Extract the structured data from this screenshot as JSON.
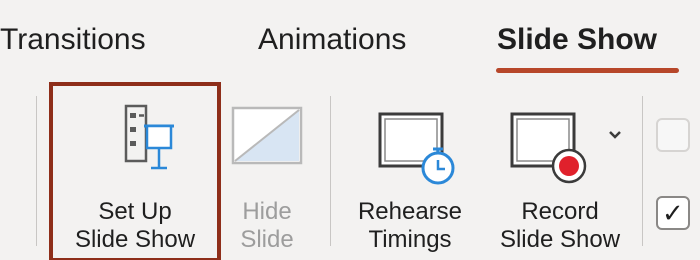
{
  "tabs": [
    {
      "label": "Transitions",
      "active": false
    },
    {
      "label": "Animations",
      "active": false
    },
    {
      "label": "Slide Show",
      "active": true
    }
  ],
  "accent_color": "#b7472a",
  "highlight_color": "#8e2e1a",
  "ribbon": {
    "setup": {
      "line1": "Set Up",
      "line2": "Slide Show",
      "icon": "setup-slideshow-icon",
      "highlighted": true
    },
    "hide": {
      "line1": "Hide",
      "line2": "Slide",
      "icon": "hide-slide-icon",
      "disabled": true
    },
    "rehearse": {
      "line1": "Rehearse",
      "line2": "Timings",
      "icon": "rehearse-timings-icon"
    },
    "record": {
      "line1": "Record",
      "line2": "Slide Show",
      "icon": "record-slideshow-icon",
      "has_dropdown": true
    }
  },
  "checkboxes": [
    {
      "checked": false,
      "state": "disabled"
    },
    {
      "checked": true,
      "glyph": "✓"
    }
  ]
}
